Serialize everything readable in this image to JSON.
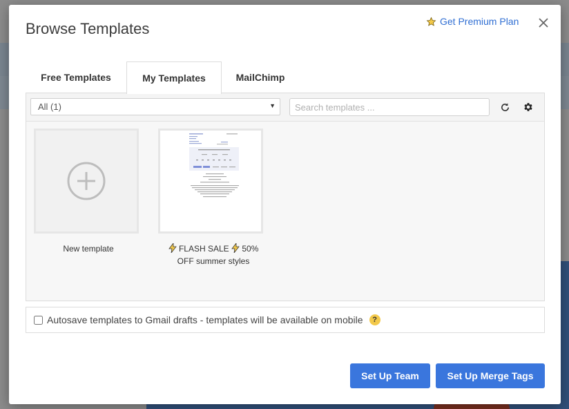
{
  "modal": {
    "title": "Browse Templates",
    "premium_label": "Get Premium Plan",
    "close_icon": "close-icon"
  },
  "tabs": [
    {
      "label": "Free Templates",
      "active": false
    },
    {
      "label": "My Templates",
      "active": true
    },
    {
      "label": "MailChimp",
      "active": false
    }
  ],
  "toolbar": {
    "filter_value": "All (1)",
    "search_placeholder": "Search templates ...",
    "refresh_icon": "refresh-icon",
    "settings_icon": "gear-icon"
  },
  "templates": [
    {
      "label": "New template",
      "icon": "plus-circle-icon"
    },
    {
      "label_parts": [
        "FLASH SALE",
        "50%",
        "OFF summer styles"
      ],
      "icon": "lightning-icon"
    }
  ],
  "autosave": {
    "checked": false,
    "label": "Autosave templates to Gmail drafts - templates will be available on mobile",
    "help": "?"
  },
  "buttons": {
    "team": "Set Up Team",
    "merge": "Set Up Merge Tags"
  },
  "colors": {
    "accent": "#3a76dd",
    "link": "#2f6ed3",
    "star": "#f3c94a"
  }
}
